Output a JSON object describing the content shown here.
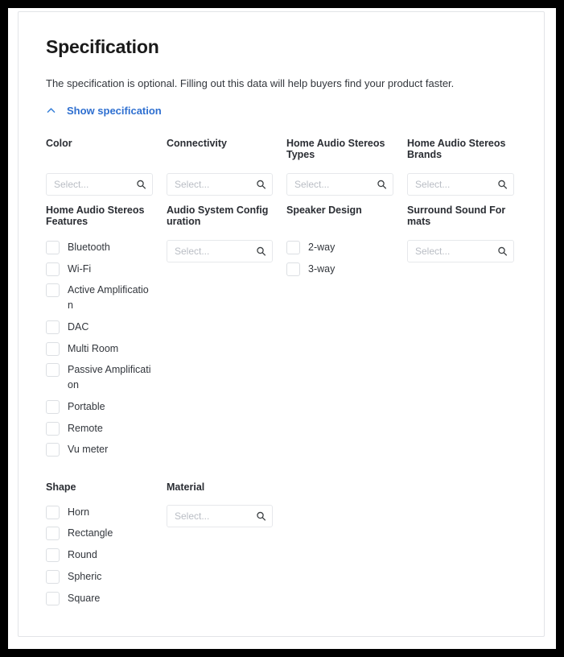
{
  "page": {
    "title": "Specification",
    "description": "The specification is optional. Filling out this data will help buyers find your product faster.",
    "toggle_label": "Show specification",
    "toggle_icon": "chevron-up-icon",
    "select_placeholder": "Select...",
    "search_icon": "search-icon",
    "accent_color": "#2e6fd0",
    "label_color": "#2a2d33",
    "border_color": "#e6e8eb"
  },
  "rows": [
    {
      "id": "row-1",
      "fields": [
        {
          "id": "color",
          "label": "Color",
          "type": "select",
          "value": "",
          "placeholder": "Select..."
        },
        {
          "id": "connectivity",
          "label": "Connectivity",
          "type": "select",
          "value": "",
          "placeholder": "Select..."
        },
        {
          "id": "home-audio-stereos-types",
          "label": "Home Audio Stereos Types",
          "type": "select",
          "value": "",
          "placeholder": "Select..."
        },
        {
          "id": "home-audio-stereos-brands",
          "label": "Home Audio Stereos Brands",
          "type": "select",
          "value": "",
          "placeholder": "Select..."
        }
      ]
    },
    {
      "id": "row-2",
      "fields": [
        {
          "id": "home-audio-stereos-features",
          "label": "Home Audio Stereos Features",
          "type": "checkbox-list",
          "options": [
            {
              "label": "Bluetooth",
              "checked": false
            },
            {
              "label": "Wi-Fi",
              "checked": false
            },
            {
              "label": "Active Amplification",
              "checked": false
            },
            {
              "label": "DAC",
              "checked": false
            },
            {
              "label": "Multi Room",
              "checked": false
            },
            {
              "label": "Passive Amplification",
              "checked": false
            },
            {
              "label": "Portable",
              "checked": false
            },
            {
              "label": "Remote",
              "checked": false
            },
            {
              "label": "Vu meter",
              "checked": false
            }
          ]
        },
        {
          "id": "audio-system-configuration",
          "label": "Audio System Configuration",
          "type": "select",
          "value": "",
          "placeholder": "Select..."
        },
        {
          "id": "speaker-design",
          "label": "Speaker Design",
          "type": "checkbox-list",
          "options": [
            {
              "label": "2-way",
              "checked": false
            },
            {
              "label": "3-way",
              "checked": false
            }
          ]
        },
        {
          "id": "surround-sound-formats",
          "label": "Surround Sound Formats",
          "type": "select",
          "value": "",
          "placeholder": "Select..."
        }
      ]
    },
    {
      "id": "row-3",
      "fields": [
        {
          "id": "shape",
          "label": "Shape",
          "type": "checkbox-list",
          "options": [
            {
              "label": "Horn",
              "checked": false
            },
            {
              "label": "Rectangle",
              "checked": false
            },
            {
              "label": "Round",
              "checked": false
            },
            {
              "label": "Spheric",
              "checked": false
            },
            {
              "label": "Square",
              "checked": false
            }
          ]
        },
        {
          "id": "material",
          "label": "Material",
          "type": "select",
          "value": "",
          "placeholder": "Select..."
        }
      ]
    }
  ]
}
